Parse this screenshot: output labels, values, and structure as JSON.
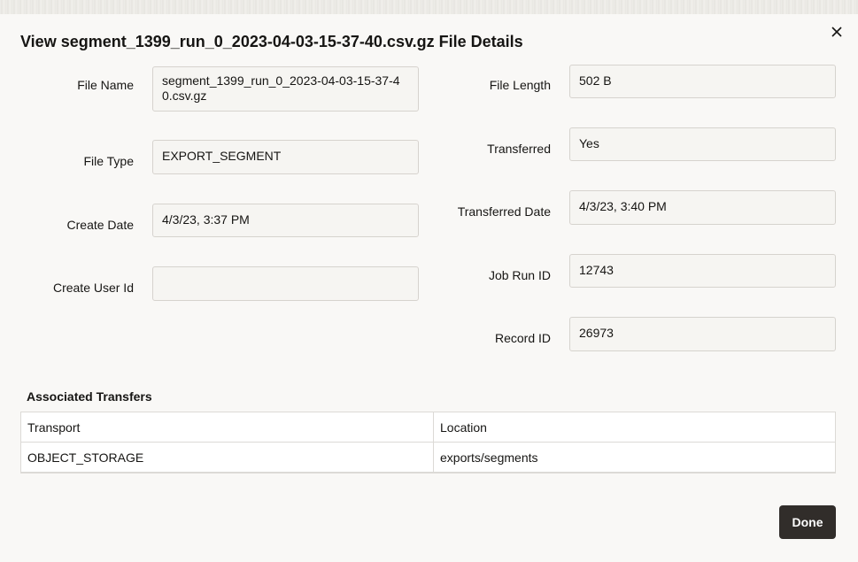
{
  "dialog": {
    "title": "View segment_1399_run_0_2023-04-03-15-37-40.csv.gz File Details",
    "close_icon": "close-icon"
  },
  "fields": {
    "file_name": {
      "label": "File Name",
      "value": "segment_1399_run_0_2023-04-03-15-37-40.csv.gz"
    },
    "file_type": {
      "label": "File Type",
      "value": "EXPORT_SEGMENT"
    },
    "create_date": {
      "label": "Create Date",
      "value": "4/3/23, 3:37 PM"
    },
    "create_user_id": {
      "label": "Create User Id",
      "value": ""
    },
    "file_length": {
      "label": "File Length",
      "value": "502 B"
    },
    "transferred": {
      "label": "Transferred",
      "value": "Yes"
    },
    "transferred_date": {
      "label": "Transferred Date",
      "value": "4/3/23, 3:40 PM"
    },
    "job_run_id": {
      "label": "Job Run ID",
      "value": "12743"
    },
    "record_id": {
      "label": "Record ID",
      "value": "26973"
    }
  },
  "transfers": {
    "title": "Associated Transfers",
    "columns": [
      "Transport",
      "Location"
    ],
    "rows": [
      [
        "OBJECT_STORAGE",
        "exports/segments"
      ]
    ]
  },
  "footer": {
    "done_label": "Done"
  }
}
